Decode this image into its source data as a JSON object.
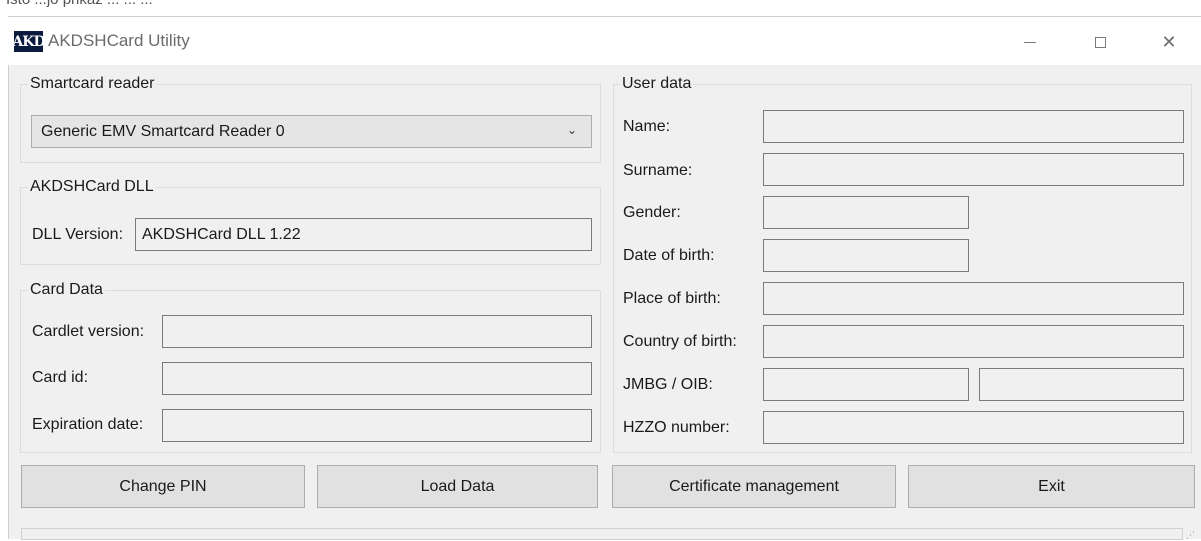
{
  "header_fragment": "Isto ...jo prikaz ... ... ...",
  "window": {
    "title": "AKDSHCard Utility",
    "logo_text": "AKD"
  },
  "smartcard": {
    "legend": "Smartcard reader",
    "reader_selected": "Generic EMV Smartcard Reader 0"
  },
  "dll": {
    "legend": "AKDSHCard DLL",
    "version_label": "DLL Version:",
    "version_value": "AKDSHCard DLL 1.22"
  },
  "card_data": {
    "legend": "Card Data",
    "cardlet_label": "Cardlet version:",
    "cardlet_value": "",
    "card_id_label": "Card id:",
    "card_id_value": "",
    "expiration_label": "Expiration date:",
    "expiration_value": ""
  },
  "user_data": {
    "legend": "User data",
    "name_label": "Name:",
    "name_value": "",
    "surname_label": "Surname:",
    "surname_value": "",
    "gender_label": "Gender:",
    "gender_value": "",
    "dob_label": "Date of birth:",
    "dob_value": "",
    "pob_label": "Place of birth:",
    "pob_value": "",
    "cob_label": "Country of birth:",
    "cob_value": "",
    "jmbg_label": "JMBG / OIB:",
    "jmbg_value": "",
    "oib_value": "",
    "hzzo_label": "HZZO number:",
    "hzzo_value": ""
  },
  "buttons": {
    "change_pin": "Change PIN",
    "load_data": "Load Data",
    "cert_mgmt": "Certificate management",
    "exit": "Exit"
  },
  "icons": {
    "minimize": "minimize-icon",
    "maximize": "maximize-icon",
    "close": "close-icon",
    "dropdown": "chevron-down-icon",
    "grip": "resize-grip-icon"
  },
  "colors": {
    "window_bg": "#f0f0f0",
    "button_bg": "#e1e1e1",
    "logo_bg": "#0a1b3d"
  }
}
